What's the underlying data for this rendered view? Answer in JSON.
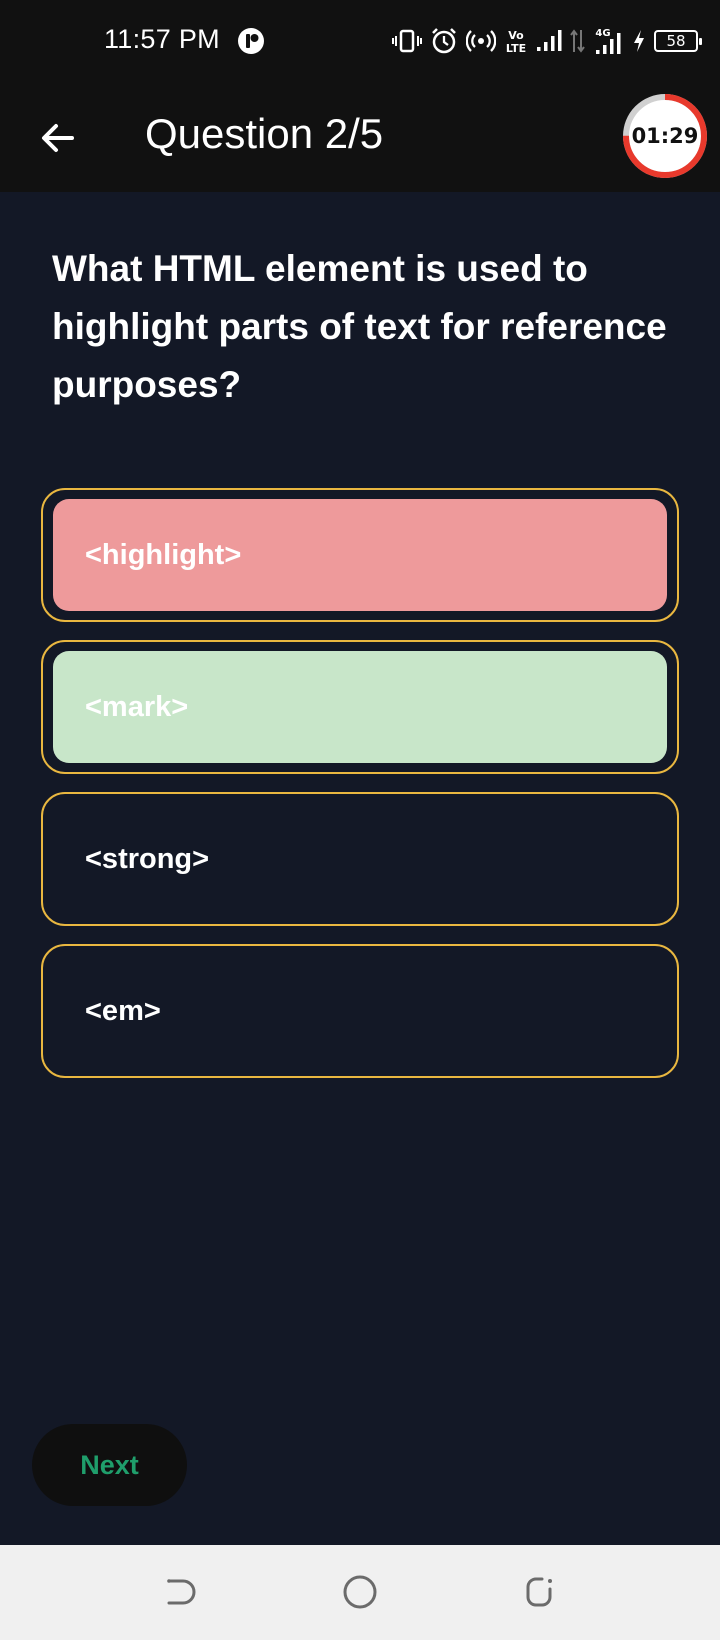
{
  "status_bar": {
    "time": "11:57 PM",
    "battery": "58",
    "icons": [
      "app-notification-icon",
      "vibrate-icon",
      "alarm-icon",
      "hotspot-icon",
      "volte-icon",
      "signal-icon",
      "data-arrows-icon",
      "signal-4g-icon",
      "charging-icon",
      "battery-icon"
    ]
  },
  "app_bar": {
    "title": "Question 2/5",
    "timer": "01:29",
    "timer_progress": 0.75,
    "colors": {
      "timer_ring": "#e8392c",
      "timer_track": "#d0d0d0"
    }
  },
  "question": {
    "text": "What HTML element is used to highlight parts of text for reference purposes?"
  },
  "options": [
    {
      "label": "<highlight>",
      "state": "incorrect",
      "fill": "#ee9a9b"
    },
    {
      "label": "<mark>",
      "state": "correct",
      "fill": "#c8e6c9"
    },
    {
      "label": "<strong>",
      "state": "default",
      "fill": ""
    },
    {
      "label": "<em>",
      "state": "default",
      "fill": ""
    }
  ],
  "next_button": {
    "label": "Next",
    "color": "#1f9e6b"
  },
  "nav_bar": {
    "buttons": [
      "back-gesture-icon",
      "home-icon",
      "recents-icon"
    ]
  },
  "colors": {
    "background": "#131826",
    "option_border": "#e9b740",
    "bar": "#111111"
  }
}
